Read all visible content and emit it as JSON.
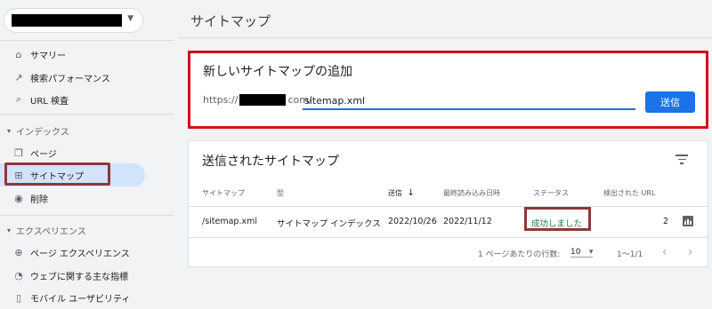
{
  "sidebar": {
    "items": [
      {
        "label": "サマリー",
        "icon": "home-icon"
      },
      {
        "label": "検索パフォーマンス",
        "icon": "trending-icon"
      },
      {
        "label": "URL 検査",
        "icon": "search-icon"
      }
    ],
    "index_section": {
      "header": "インデックス",
      "items": [
        {
          "label": "ページ",
          "icon": "pages-icon"
        },
        {
          "label": "サイトマップ",
          "icon": "sitemap-icon"
        },
        {
          "label": "削除",
          "icon": "eye-off-icon"
        }
      ]
    },
    "experience_section": {
      "header": "エクスペリエンス",
      "items": [
        {
          "label": "ページ エクスペリエンス",
          "icon": "plus-circle-icon"
        },
        {
          "label": "ウェブに関する主な指標",
          "icon": "speed-icon"
        },
        {
          "label": "モバイル ユーザビリティ",
          "icon": "phone-icon"
        }
      ]
    }
  },
  "main": {
    "title": "サイトマップ",
    "add_card": {
      "title": "新しいサイトマップの追加",
      "url_prefix_start": "https://",
      "url_prefix_end": "com/",
      "input_value": "sitemap.xml",
      "submit_label": "送信"
    },
    "list_card": {
      "title": "送信されたサイトマップ",
      "columns": [
        "サイトマップ",
        "型",
        "送信",
        "最終読み込み日時",
        "ステータス",
        "検出された URL"
      ],
      "sort_arrow": "↓",
      "row": {
        "sitemap": "/sitemap.xml",
        "type": "サイトマップ インデックス",
        "submitted": "2022/10/26",
        "last_read": "2022/11/12",
        "status": "成功しました",
        "urls": "2"
      },
      "pager": {
        "rows_label": "1 ページあたりの行数:",
        "rows_value": "10",
        "range": "1〜1/1",
        "prev": "‹",
        "next": "›"
      }
    }
  },
  "colors": {
    "accent": "#1a73e8",
    "highlight_red": "#d0101b",
    "highlight_brown": "#8b3a3a",
    "success": "#188038"
  }
}
